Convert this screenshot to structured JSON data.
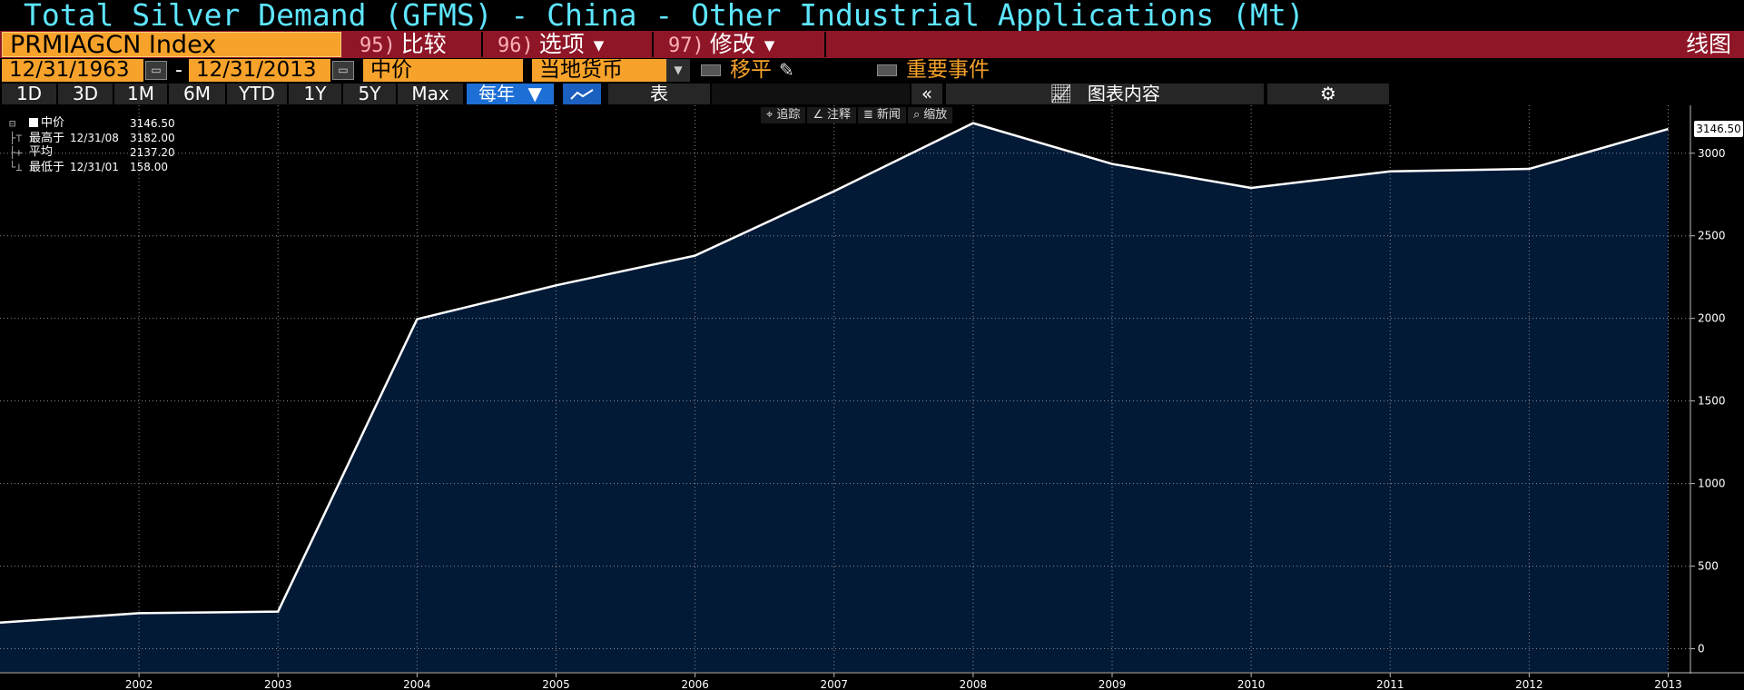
{
  "header": {
    "title": "Total Silver Demand (GFMS) - China - Other Industrial Applications (Mt)"
  },
  "command_row": {
    "ticker": "PRMIAGCN Index",
    "buttons": [
      {
        "num": "95)",
        "label": "比较",
        "caret": false
      },
      {
        "num": "96)",
        "label": "选项",
        "caret": true
      },
      {
        "num": "97)",
        "label": "修改",
        "caret": true
      }
    ],
    "chart_type": "线图"
  },
  "date_row": {
    "start_date": "12/31/1963",
    "separator": "-",
    "end_date": "12/31/2013",
    "field": "中价",
    "currency": "当地货币",
    "shift_label": "移平",
    "events_label": "重要事件"
  },
  "period_row": {
    "periods": [
      "1D",
      "3D",
      "1M",
      "6M",
      "YTD",
      "1Y",
      "5Y",
      "Max"
    ],
    "frequency": "每年",
    "table_label": "表",
    "collapse": "«",
    "chart_content": "图表内容"
  },
  "legend": {
    "rows": [
      {
        "sym": "⊟",
        "name": "中价",
        "date": "",
        "value": "3146.50",
        "marker": true
      },
      {
        "sym": "├⊤",
        "name": "最高于",
        "date": "12/31/08",
        "value": "3182.00",
        "marker": false
      },
      {
        "sym": "├+",
        "name": "平均",
        "date": "",
        "value": "2137.20",
        "marker": false
      },
      {
        "sym": "└⊥",
        "name": "最低于",
        "date": "12/31/01",
        "value": "158.00",
        "marker": false
      }
    ]
  },
  "tools": {
    "items": [
      {
        "icon": "crosshair-icon",
        "glyph": "⌖",
        "label": "追踪"
      },
      {
        "icon": "annotate-icon",
        "glyph": "∠",
        "label": "注释"
      },
      {
        "icon": "news-icon",
        "glyph": "≣",
        "label": "新闻"
      },
      {
        "icon": "zoom-icon",
        "glyph": "⌕",
        "label": "缩放"
      }
    ]
  },
  "colors": {
    "title": "#5ee6ff",
    "command_bar": "#8f1627",
    "amber": "#f7a22a",
    "area_fill": "#031a37",
    "line": "#ffffff",
    "active_blue": "#1d6fd6"
  },
  "chart_data": {
    "type": "area",
    "title": "Total Silver Demand (GFMS) - China - Other Industrial Applications (Mt)",
    "x": [
      2001,
      2002,
      2003,
      2004,
      2005,
      2006,
      2007,
      2008,
      2009,
      2010,
      2011,
      2012,
      2013
    ],
    "x_tick_labels": [
      "2002",
      "2003",
      "2004",
      "2005",
      "2006",
      "2007",
      "2008",
      "2009",
      "2010",
      "2011",
      "2012",
      "2013"
    ],
    "series": [
      {
        "name": "中价",
        "values": [
          158,
          215,
          225,
          1995,
          2200,
          2380,
          2770,
          3182,
          2935,
          2790,
          2890,
          2905,
          3146.5
        ]
      }
    ],
    "last_value_label": "3146.50",
    "y_ticks": [
      0,
      500,
      1000,
      1500,
      2000,
      2500,
      3000
    ],
    "ylim": [
      -140,
      3290
    ],
    "xlim": [
      2001,
      2013.16
    ],
    "grid": true,
    "y_axis_side": "right"
  }
}
